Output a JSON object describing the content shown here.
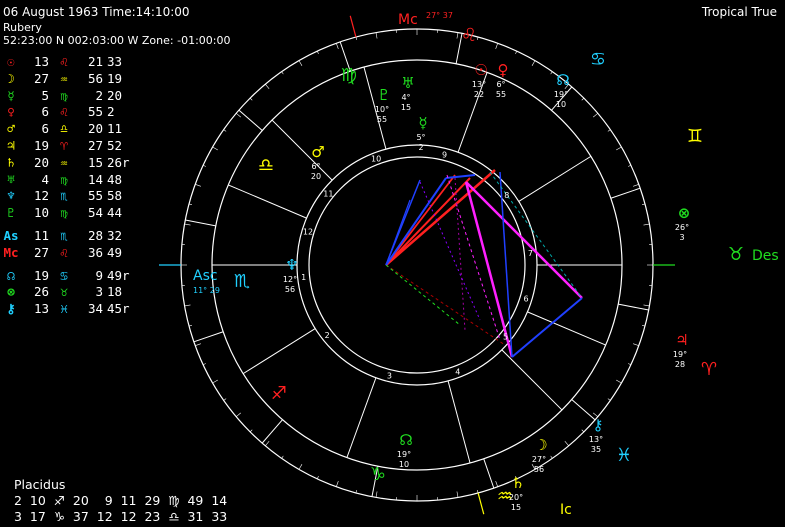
{
  "header": {
    "date_time": "06 August 1963   Time:14:10:00",
    "place": "Rubery",
    "coords": "52:23:00 N 002:03:00 W  Zone: -01:00:00",
    "zodiac": "Tropical True"
  },
  "colors": {
    "fire": "#ff2020",
    "earth": "#20dd20",
    "air": "#ffff00",
    "water": "#20d0ff",
    "magenta": "#ff20ff",
    "blue": "#2040ff",
    "text": "#ffffff"
  },
  "planets": [
    {
      "glyph": "☉",
      "color": "#ff2020",
      "deg": "13",
      "sign": "♌",
      "sign_color": "#ff2020",
      "min": "21",
      "sec": "33"
    },
    {
      "glyph": "☽",
      "color": "#ffff00",
      "deg": "27",
      "sign": "♒",
      "sign_color": "#ffff00",
      "min": "56",
      "sec": "19"
    },
    {
      "glyph": "☿",
      "color": "#20dd20",
      "deg": "5",
      "sign": "♍",
      "sign_color": "#20dd20",
      "min": "2",
      "sec": "20"
    },
    {
      "glyph": "♀",
      "color": "#ff2020",
      "deg": "6",
      "sign": "♌",
      "sign_color": "#ff2020",
      "min": "55",
      "sec": "2"
    },
    {
      "glyph": "♂",
      "color": "#ffff00",
      "deg": "6",
      "sign": "♎",
      "sign_color": "#ffff00",
      "min": "20",
      "sec": "11"
    },
    {
      "glyph": "♃",
      "color": "#ffff00",
      "deg": "19",
      "sign": "♈",
      "sign_color": "#ff2020",
      "min": "27",
      "sec": "52"
    },
    {
      "glyph": "♄",
      "color": "#ffff00",
      "deg": "20",
      "sign": "♒",
      "sign_color": "#ffff00",
      "min": "15",
      "sec": "26r"
    },
    {
      "glyph": "♅",
      "color": "#20dd20",
      "deg": "4",
      "sign": "♍",
      "sign_color": "#20dd20",
      "min": "14",
      "sec": "48"
    },
    {
      "glyph": "♆",
      "color": "#20d0ff",
      "deg": "12",
      "sign": "♏",
      "sign_color": "#20d0ff",
      "min": "55",
      "sec": "58"
    },
    {
      "glyph": "♇",
      "color": "#20dd20",
      "deg": "10",
      "sign": "♍",
      "sign_color": "#20dd20",
      "min": "54",
      "sec": "44"
    }
  ],
  "angles": [
    {
      "glyph": "As",
      "color": "#20d0ff",
      "deg": "11",
      "sign": "♏",
      "sign_color": "#20d0ff",
      "min": "28",
      "sec": "32"
    },
    {
      "glyph": "Mc",
      "color": "#ff2020",
      "deg": "27",
      "sign": "♌",
      "sign_color": "#ff2020",
      "min": "36",
      "sec": "49"
    }
  ],
  "points": [
    {
      "glyph": "☊",
      "color": "#20d0ff",
      "deg": "19",
      "sign": "♋",
      "sign_color": "#20d0ff",
      "min": "9",
      "sec": "49r"
    },
    {
      "glyph": "⊗",
      "color": "#20dd20",
      "deg": "26",
      "sign": "♉",
      "sign_color": "#20dd20",
      "min": "3",
      "sec": "18"
    },
    {
      "glyph": "⚷",
      "color": "#20d0ff",
      "deg": "13",
      "sign": "♓",
      "sign_color": "#20d0ff",
      "min": "34",
      "sec": "45r"
    }
  ],
  "houses": {
    "system": "Placidus",
    "row1": "2  10  ♐  20    9  11  29  ♍  49  14",
    "row2": "3  17  ♑  37  12  12  23  ♎  31  33"
  },
  "wheel": {
    "angle_labels": [
      {
        "id": "asc",
        "text": "Asc",
        "sub": "11° 29",
        "color": "#20d0ff"
      },
      {
        "id": "des",
        "text": "Des",
        "color": "#20dd20"
      },
      {
        "id": "mc",
        "text": "Mc",
        "sub": "27° 37",
        "color": "#ff2020"
      },
      {
        "id": "ic",
        "text": "Ic",
        "color": "#ffff00"
      }
    ],
    "house_numbers": [
      "1",
      "2",
      "3",
      "4",
      "5",
      "6",
      "7",
      "8",
      "9",
      "10",
      "11",
      "12"
    ],
    "signs": [
      {
        "glyph": "♌",
        "color": "#ff2020"
      },
      {
        "glyph": "♋",
        "color": "#20d0ff"
      },
      {
        "glyph": "♊",
        "color": "#ffff00"
      },
      {
        "glyph": "♉",
        "color": "#20dd20"
      },
      {
        "glyph": "♈",
        "color": "#ff2020"
      },
      {
        "glyph": "♓",
        "color": "#20d0ff"
      },
      {
        "glyph": "♒",
        "color": "#ffff00"
      },
      {
        "glyph": "♑",
        "color": "#20dd20"
      },
      {
        "glyph": "♐",
        "color": "#ff2020"
      },
      {
        "glyph": "♏",
        "color": "#20d0ff"
      },
      {
        "glyph": "♎",
        "color": "#ffff00"
      },
      {
        "glyph": "♍",
        "color": "#20dd20"
      }
    ],
    "planet_labels": [
      {
        "glyph": "☉",
        "color": "#ff2020",
        "a": "13°",
        "b": "22"
      },
      {
        "glyph": "♀",
        "color": "#ff2020",
        "a": "6°",
        "b": "55"
      },
      {
        "glyph": "☊",
        "color": "#20d0ff",
        "a": "19°",
        "b": "10"
      },
      {
        "glyph": "♅",
        "color": "#20dd20",
        "a": "4°",
        "b": "15"
      },
      {
        "glyph": "♇",
        "color": "#20dd20",
        "a": "10°",
        "b": "55"
      },
      {
        "glyph": "☿",
        "color": "#20dd20",
        "a": "5°",
        "b": "2"
      },
      {
        "glyph": "♂",
        "color": "#ffff00",
        "a": "6°",
        "b": "20"
      },
      {
        "glyph": "⊗",
        "color": "#20dd20",
        "a": "26°",
        "b": "3"
      },
      {
        "glyph": "♃",
        "color": "#ff2020",
        "a": "19°",
        "b": "28"
      },
      {
        "glyph": "⚷",
        "color": "#20d0ff",
        "a": "13°",
        "b": "35"
      },
      {
        "glyph": "☽",
        "color": "#ffff00",
        "a": "27°",
        "b": "56"
      },
      {
        "glyph": "♄",
        "color": "#ffff00",
        "a": "20°",
        "b": "15"
      },
      {
        "glyph": "☊",
        "color": "#20dd20",
        "a": "19°",
        "b": "10"
      },
      {
        "glyph": "♆",
        "color": "#20d0ff",
        "a": "12°",
        "b": "56"
      }
    ]
  }
}
